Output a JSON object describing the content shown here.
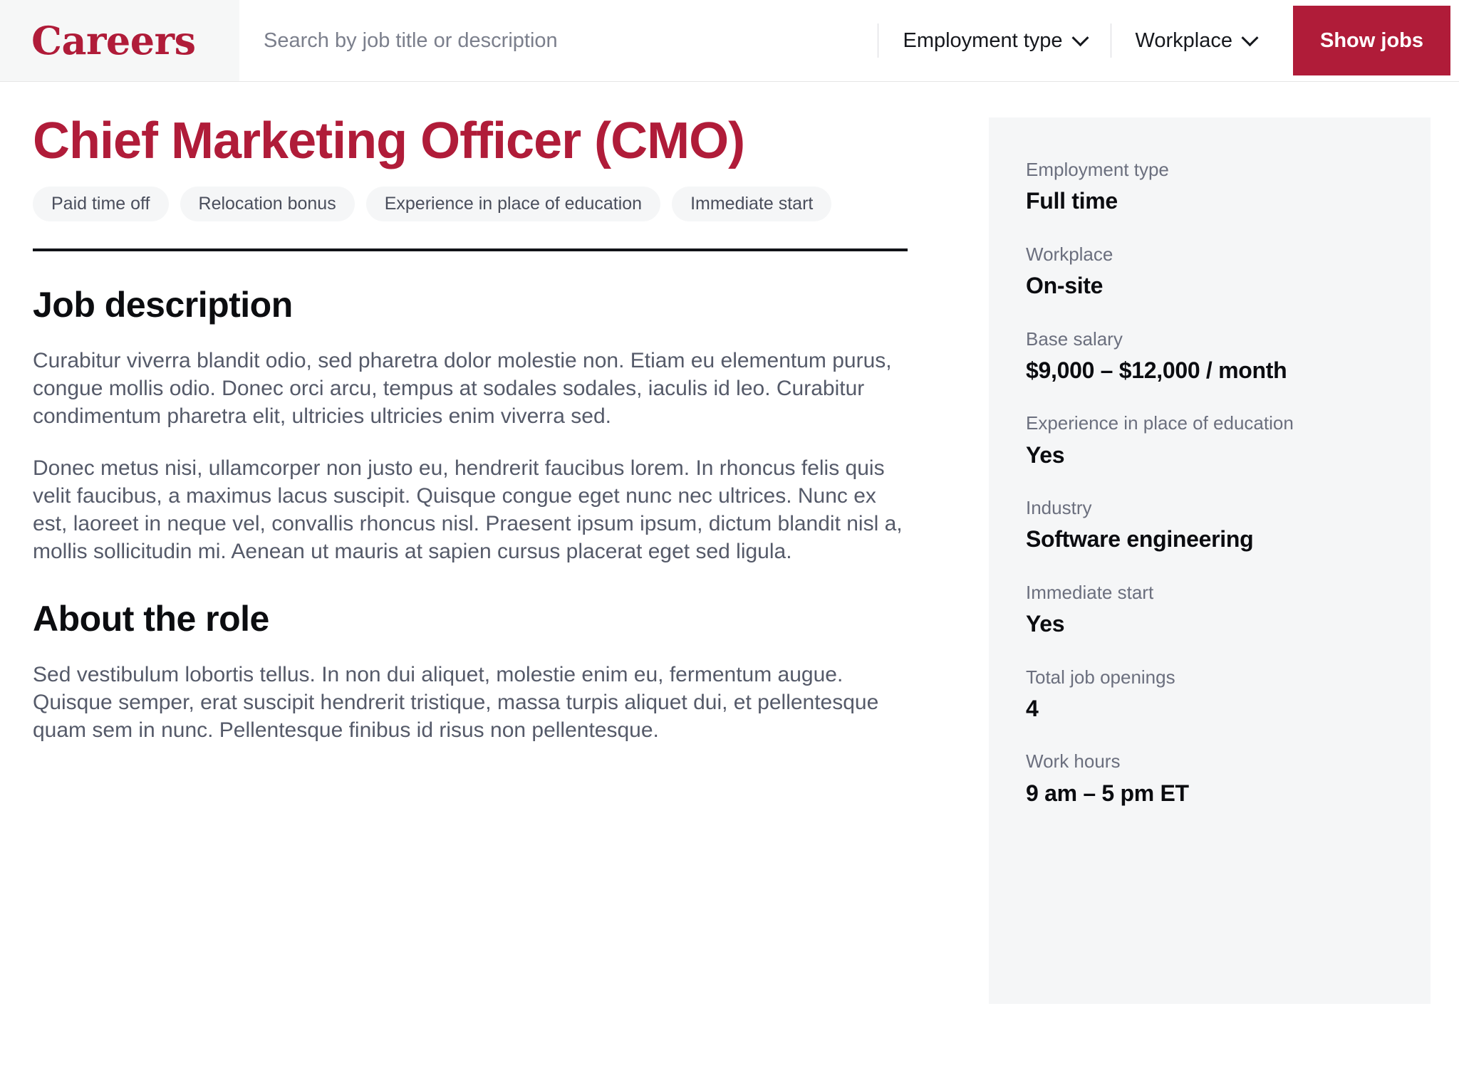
{
  "header": {
    "logo": "Careers",
    "search": {
      "placeholder": "Search by job title or description",
      "value": ""
    },
    "filters": [
      {
        "label": "Employment type",
        "icon": "chevron-down-icon"
      },
      {
        "label": "Workplace",
        "icon": "chevron-down-icon"
      }
    ],
    "show_jobs_label": "Show jobs"
  },
  "job": {
    "title": "Chief Marketing Officer (CMO)",
    "tags": [
      "Paid time off",
      "Relocation bonus",
      "Experience in place of education",
      "Immediate start"
    ],
    "sections": [
      {
        "heading": "Job description",
        "paragraphs": [
          "Curabitur viverra blandit odio, sed pharetra dolor molestie non. Etiam eu elementum purus, congue mollis odio. Donec orci arcu, tempus at sodales sodales, iaculis id leo. Curabitur condimentum pharetra elit, ultricies ultricies enim viverra sed.",
          "Donec metus nisi, ullamcorper non justo eu, hendrerit faucibus lorem. In rhoncus felis quis velit faucibus, a maximus lacus suscipit. Quisque congue eget nunc nec ultrices. Nunc ex est, laoreet in neque vel, convallis rhoncus nisl. Praesent ipsum ipsum, dictum blandit nisl a, mollis sollicitudin mi. Aenean ut mauris at sapien cursus placerat eget sed ligula."
        ]
      },
      {
        "heading": "About the role",
        "paragraphs": [
          "Sed vestibulum lobortis tellus. In non dui aliquet, molestie enim eu, fermentum augue. Quisque semper, erat suscipit hendrerit tristique, massa turpis aliquet dui, et pellentesque quam sem in nunc. Pellentesque finibus id risus non pellentesque."
        ]
      }
    ]
  },
  "sidebar": {
    "items": [
      {
        "label": "Employment type",
        "value": "Full time"
      },
      {
        "label": "Workplace",
        "value": "On-site"
      },
      {
        "label": "Base salary",
        "value": "$9,000 – $12,000 / month"
      },
      {
        "label": "Experience in place of education",
        "value": "Yes"
      },
      {
        "label": "Industry",
        "value": "Software engineering"
      },
      {
        "label": "Immediate start",
        "value": "Yes"
      },
      {
        "label": "Total job openings",
        "value": "4"
      },
      {
        "label": "Work hours",
        "value": "9 am – 5 pm ET"
      }
    ]
  },
  "colors": {
    "accent": "#b01c39",
    "panel_bg": "#f5f6f7",
    "body_text": "#555a69",
    "label_text": "#6b6f7e"
  }
}
